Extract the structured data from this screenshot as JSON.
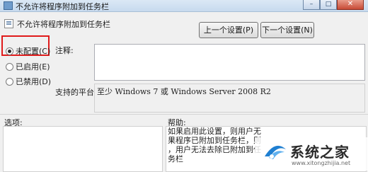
{
  "window": {
    "title": "不允许将程序附加到任务栏",
    "minimize_glyph": "–",
    "maximize_glyph": "□",
    "close_glyph": "✕"
  },
  "header": {
    "policy_name": "不允许将程序附加到任务栏",
    "prev_button": "上一个设置(P)",
    "next_button": "下一个设置(N)"
  },
  "options": [
    {
      "label": "未配置(C)",
      "selected": true
    },
    {
      "label": "已启用(E)",
      "selected": false
    },
    {
      "label": "已禁用(D)",
      "selected": false
    }
  ],
  "comment_label": "注释:",
  "supported_label": "支持的平台:",
  "supported_value": "至少 Windows 7 或 Windows Server 2008 R2",
  "options_section_label": "选项:",
  "help_section_label": "帮助:",
  "help_text": "如果启用此设置，则用户无\n果程序已附加到任务栏，则\n，用户无法去除已附加到任\n务栏",
  "watermark": {
    "text": "系统之家",
    "url": "www.xitongzhijia.net"
  },
  "colors": {
    "highlight_border": "#e01b1b",
    "close_button": "#c74b36"
  }
}
